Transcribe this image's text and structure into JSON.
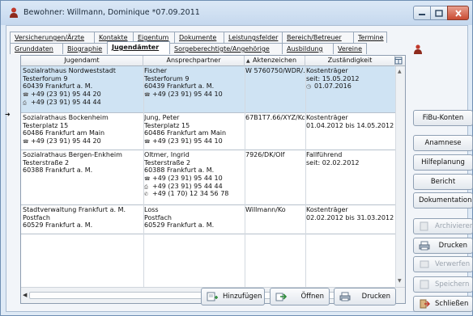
{
  "window": {
    "title": "Bewohner: Willmann, Dominique *07.09.2011"
  },
  "tabs": {
    "row1": [
      "Versicherungen/Ärzte",
      "Kontakte",
      "Eigentum",
      "Dokumente",
      "Leistungsfelder",
      "Bereich/Betreuer",
      "Termine"
    ],
    "row2": [
      "Grunddaten",
      "Biographie",
      "Jugendämter",
      "Sorgeberechtigte/Angehörige",
      "Ausbildung",
      "Vereine"
    ],
    "active": "Jugendämter"
  },
  "table": {
    "columns": [
      "Jugendamt",
      "Ansprechpartner",
      "Aktenzeichen",
      "Zuständigkeit"
    ],
    "rows": [
      {
        "jugendamt": [
          "Sozialrathaus Nordweststadt",
          "Testerforum 9",
          "60439 Frankfurt a. M.",
          "+49 (23 91) 95 44 20",
          "+49 (23 91) 95 44 44"
        ],
        "ansprechpartner": [
          "Fischer",
          "Testerforum 9",
          "60439 Frankfurt a. M.",
          "+49 (23 91) 95 44 10"
        ],
        "aktenzeichen": "W 5760750/WDR/…",
        "zustaendigkeit": [
          "Kostenträger",
          "seit: 15.05.2012",
          "01.07.2016"
        ]
      },
      {
        "jugendamt": [
          "Sozialrathaus Bockenheim",
          "Testerplatz 15",
          "60486 Frankfurt am Main",
          "+49 (23 91) 95 44 20"
        ],
        "ansprechpartner": [
          "Jung, Peter",
          "Testerplatz 15",
          "60486 Frankfurt am Main",
          "+49 (23 91) 95 44 10"
        ],
        "aktenzeichen": "67B1T7.66/XYZ/Ko",
        "zustaendigkeit": [
          "Kostenträger",
          "01.04.2012 bis 14.05.2012"
        ]
      },
      {
        "jugendamt": [
          "Sozialrathaus Bergen-Enkheim",
          "Testerstraße 2",
          "60388 Frankfurt a. M."
        ],
        "ansprechpartner": [
          "Oltmer, Ingrid",
          "Testerstraße 2",
          "60388 Frankfurt a. M.",
          "+49 (23 91) 95 44 10",
          "+49 (23 91) 95 44 44",
          "+49 (1 70) 12 34 56 78"
        ],
        "aktenzeichen": "7926/DK/Olf",
        "zustaendigkeit": [
          "Fallführend",
          "seit: 02.02.2012"
        ]
      },
      {
        "jugendamt": [
          "Stadtverwaltung Frankfurt a. M.",
          "Postfach",
          "60529 Frankfurt a. M."
        ],
        "ansprechpartner": [
          "Loss",
          "Postfach",
          "60529 Frankfurt a. M."
        ],
        "aktenzeichen": "Willmann/Ko",
        "zustaendigkeit": [
          "Kostenträger",
          "02.02.2012 bis 31.03.2012"
        ]
      }
    ]
  },
  "bottom_buttons": {
    "add": "Hinzufügen",
    "open": "Öffnen",
    "print": "Drucken"
  },
  "side_buttons": {
    "fibu": "FiBu-Konten",
    "anamnese": "Anamnese",
    "hilfeplanung": "Hilfeplanung",
    "bericht": "Bericht",
    "dokumentation": "Dokumentation",
    "archivieren": "Archivieren",
    "drucken": "Drucken",
    "verwerfen": "Verwerfen",
    "speichern": "Speichern",
    "schliessen": "Schließen"
  }
}
